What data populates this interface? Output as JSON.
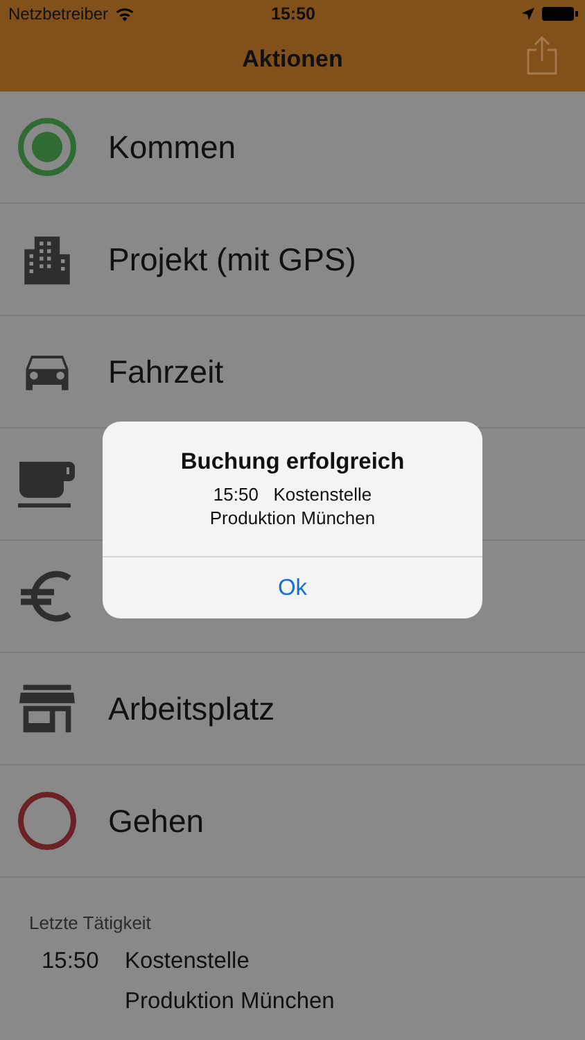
{
  "status_bar": {
    "carrier": "Netzbetreiber",
    "time": "15:50"
  },
  "nav": {
    "title": "Aktionen"
  },
  "actions": [
    {
      "kind": "ring",
      "color": "#2f6b33",
      "selected": true,
      "label": "Kommen"
    },
    {
      "kind": "icon",
      "label": "Projekt (mit GPS)"
    },
    {
      "kind": "icon",
      "label": "Fahrzeit"
    },
    {
      "kind": "icon"
    },
    {
      "kind": "icon"
    },
    {
      "kind": "icon",
      "label": "Arbeitsplatz"
    },
    {
      "kind": "ring",
      "color": "#6a2226",
      "selected": false,
      "label": "Gehen"
    }
  ],
  "last_activity": {
    "heading": "Letzte Tätigkeit",
    "time": "15:50",
    "lines": [
      "Kostenstelle",
      "Produktion München"
    ]
  },
  "alert": {
    "title": "Buchung erfolgreich",
    "message_lines": [
      "15:50   Kostenstelle",
      "Produktion München"
    ],
    "button": "Ok"
  }
}
